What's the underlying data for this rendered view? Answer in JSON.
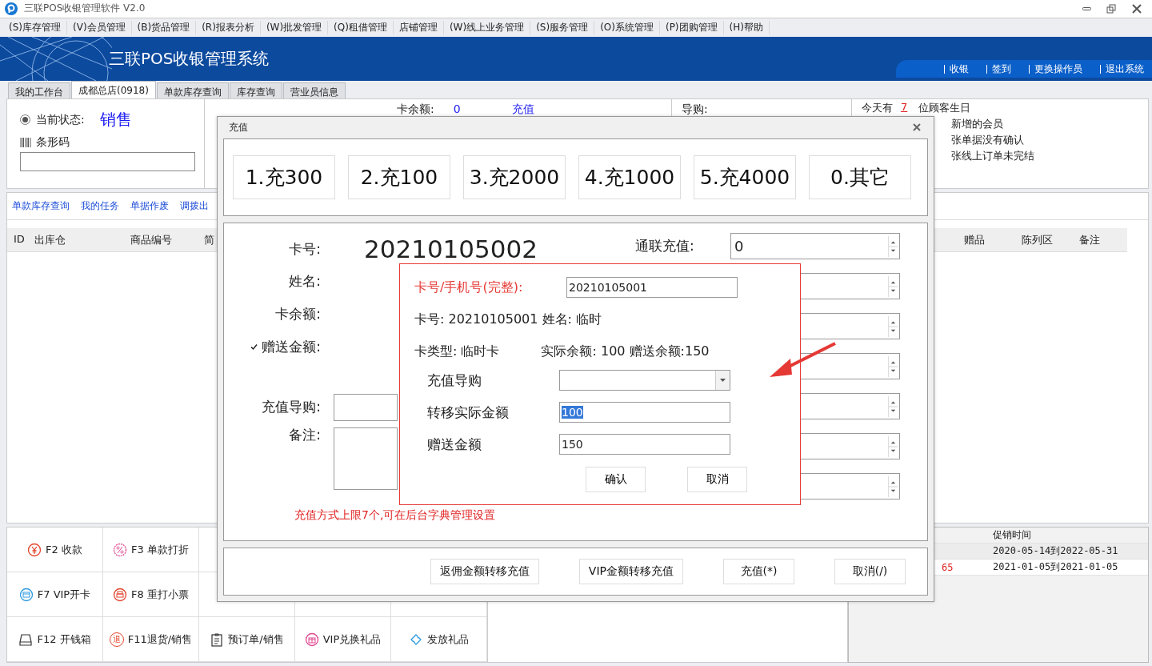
{
  "window": {
    "title": "三联POS收银管理软件 V2.0"
  },
  "menu": [
    "(S)库存管理",
    "(V)会员管理",
    "(B)货品管理",
    "(R)报表分析",
    "(W)批发管理",
    "(Q)租借管理",
    "店铺管理",
    "(W)线上业务管理",
    "(S)服务管理",
    "(O)系统管理",
    "(P)团购管理",
    "(H)帮助"
  ],
  "banner": {
    "title": "三联POS收银管理系统",
    "links": [
      "收银",
      "签到",
      "更换操作员",
      "退出系统"
    ]
  },
  "tabs": [
    {
      "label": "我的工作台",
      "selected": false
    },
    {
      "label": "成都总店(0918)",
      "selected": true
    },
    {
      "label": "单款库存查询",
      "selected": false
    },
    {
      "label": "库存查询",
      "selected": false
    },
    {
      "label": "营业员信息",
      "selected": false
    }
  ],
  "status_panel": {
    "label": "当前状态:",
    "checked": true,
    "status": "销售",
    "barcode_label": "条形码"
  },
  "card_info": {
    "balance_label": "卡余额:",
    "balance": "0",
    "recharge_link": "充值",
    "guide_label": "导购:"
  },
  "notices": [
    {
      "prefix": "今天有",
      "count": "7",
      "text": "位顾客生日"
    },
    {
      "text": "新增的会员"
    },
    {
      "text": "张单据没有确认"
    },
    {
      "text": "张线上订单未完结"
    }
  ],
  "quick_links": [
    "单款库存查询",
    "我的任务",
    "单据作废",
    "调拨出"
  ],
  "table": {
    "columns": [
      "ID",
      "出库仓",
      "商品编号",
      "简"
    ],
    "columns_right": [
      "赠品",
      "陈列区",
      "备注"
    ]
  },
  "function_rows": [
    [
      {
        "label": "F2 收款",
        "kind": "yen"
      },
      {
        "label": "F3 单款打折",
        "kind": "percent"
      }
    ],
    [
      {
        "label": "F7 VIP开卡",
        "kind": "card"
      },
      {
        "label": "F8 重打小票",
        "kind": "printer"
      }
    ],
    [
      {
        "label": "F12 开钱箱",
        "kind": "drawer"
      },
      {
        "label": "F11退货/销售",
        "kind": "glyph",
        "glyph": "退"
      },
      {
        "label": "预订单/销售",
        "kind": "clipboard"
      },
      {
        "label": "VIP兑换礼品",
        "kind": "gift"
      },
      {
        "label": "发放礼品",
        "kind": "ticket"
      }
    ]
  ],
  "promotions": {
    "columns": [
      "促销时间"
    ],
    "rows": [
      {
        "time": "2020-05-14到2022-05-31"
      },
      {
        "amount": "65",
        "time": "2021-01-05到2021-01-05"
      }
    ]
  },
  "dialog": {
    "title": "充值",
    "presets": [
      "1.充300",
      "2.充100",
      "3.充2000",
      "4.充1000",
      "5.充4000",
      "0.其它"
    ],
    "card_label": "卡号:",
    "card_no": "20210105002",
    "name_label": "姓名:",
    "balance_label": "卡余额:",
    "gift_label": "赠送金额:",
    "gift_checked": true,
    "guide_label": "充值导购:",
    "note_label": "备注:",
    "spinners": [
      {
        "kind": "spinner",
        "label": "通联充值:",
        "value": "0"
      },
      {
        "kind": "spinner"
      },
      {
        "kind": "spinner"
      },
      {
        "kind": "spinner"
      },
      {
        "kind": "spinner"
      },
      {
        "kind": "spinner"
      },
      {
        "kind": "spinner"
      }
    ],
    "note": "充值方式上限7个,可在后台字典管理设置",
    "buttons": [
      "返佣金额转移充值",
      "VIP金额转移充值",
      "充值(*)",
      "取消(/)"
    ]
  },
  "popup": {
    "lookup_label": "卡号/手机号(完整):",
    "lookup_value": "20210105001",
    "info_line": "卡号: 20210105001 姓名: 临时",
    "card_type": "卡类型: 临时卡",
    "balances": "实际余额: 100 赠送余额:150",
    "fields": [
      {
        "kind": "select",
        "label": "充值导购"
      },
      {
        "kind": "input",
        "label": "转移实际金额",
        "value": "100",
        "selected": true
      },
      {
        "kind": "input",
        "label": "赠送金额",
        "value": "150",
        "selected": false
      }
    ],
    "buttons": [
      "确认",
      "取消"
    ]
  }
}
